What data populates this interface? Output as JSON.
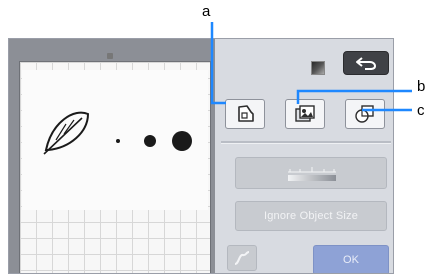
{
  "callouts": {
    "a": "a",
    "b": "b",
    "c": "c"
  },
  "panel": {
    "ignore_object_size_label": "Ignore Object Size",
    "ok_label": "OK"
  },
  "icons": {
    "back": "back-arrow-icon",
    "tool_a": "outline-shape-icon",
    "tool_b": "image-trace-icon",
    "tool_c": "overlap-shapes-icon",
    "slider": "line-thickness-slider-icon",
    "curve": "curve-icon",
    "thumbnail": "image-thumbnail-icon"
  },
  "colors": {
    "callout_line": "#1e88ff",
    "ok_button": "#8ea2d6",
    "back_button": "#3f4146"
  }
}
